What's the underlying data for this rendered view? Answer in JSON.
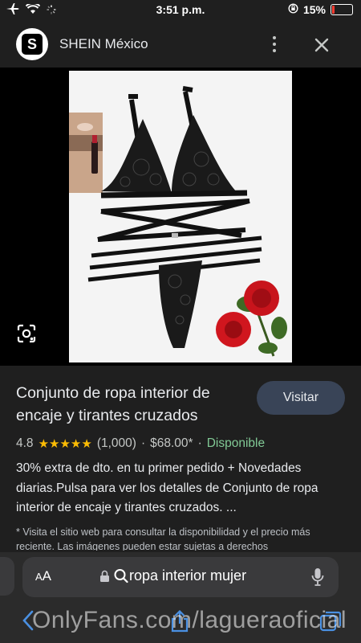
{
  "status_bar": {
    "time": "3:51 p.m.",
    "battery": "15%",
    "battery_level": 0.15
  },
  "header": {
    "logo_letter": "S",
    "site_name": "SHEIN México"
  },
  "product": {
    "title": "Conjunto de ropa interior de encaje y tirantes cruzados",
    "visit_label": "Visitar",
    "rating": "4.8",
    "stars": "★★★★★",
    "reviews": "(1,000)",
    "separator": "·",
    "price": "$68.00*",
    "availability": "Disponible",
    "description": "30% extra de dto. en tu primer pedido + Novedades diarias.Pulsa para ver los detalles de Conjunto de ropa interior de encaje y tirantes cruzados. ...",
    "note": "* Visita el sitio web para consultar la disponibilidad y el precio más reciente. Las imágenes pueden estar sujetas a derechos"
  },
  "address_bar": {
    "aa_small": "A",
    "aa_large": "A",
    "query": "ropa interior mujer"
  },
  "watermark": "OnlyFans.com/lagueraoficial",
  "colors": {
    "accent_button": "#394457",
    "stars": "#fbbc04",
    "available": "#81c995",
    "battery_low": "#ff3b30"
  }
}
